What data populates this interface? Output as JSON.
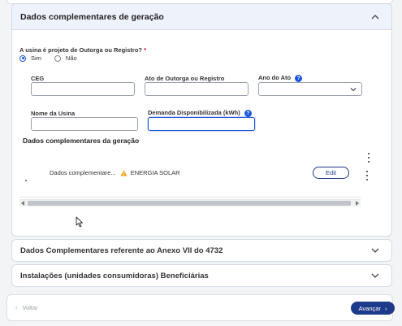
{
  "section_main": {
    "title": "Dados complementares de geração",
    "question": "A usina é projeto de Outorga ou Registro?",
    "required_mark": "*",
    "radio_options": [
      {
        "label": "Sim",
        "selected": true
      },
      {
        "label": "Não",
        "selected": false
      }
    ],
    "fields": {
      "ceg": {
        "label": "CEG",
        "value": ""
      },
      "ato": {
        "label": "Ato de Outorga ou Registro",
        "value": ""
      },
      "ano": {
        "label": "Ano do Ato",
        "value": ""
      },
      "nome": {
        "label": "Nome da Usina",
        "value": ""
      },
      "demanda": {
        "label": "Demanda Disponibilizada (kWh)",
        "value": ""
      }
    },
    "subsection": {
      "title": "Dados complementares da geração",
      "rows": [
        {
          "name": "Dados complementare...",
          "status": "ENERGIA SOLAR",
          "action": "Edit"
        }
      ]
    }
  },
  "accordions": [
    {
      "title": "Dados Complementares referente ao Anexo VII do 4732"
    },
    {
      "title": "Instalações (unidades consumidoras) Beneficiárias"
    }
  ],
  "footer": {
    "back_label": "Voltar",
    "next_label": "Avançar"
  },
  "colors": {
    "primary": "#1e3a8a",
    "accent": "#1a56db",
    "warning": "#e8a317",
    "required": "#d0021b"
  }
}
